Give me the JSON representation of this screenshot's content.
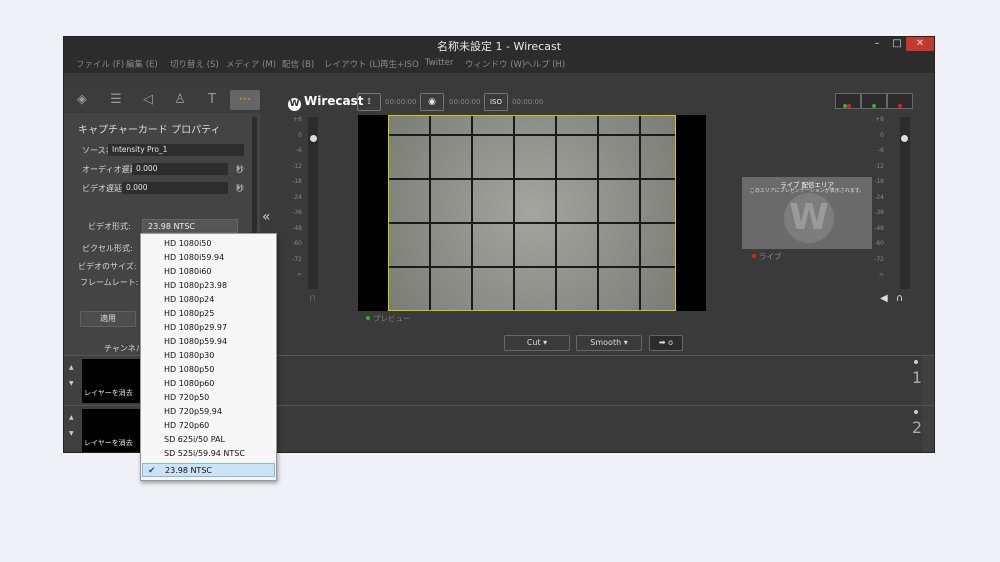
{
  "window": {
    "title": "名称未設定 1 - Wirecast",
    "controls": [
      "–",
      "□",
      "✕"
    ]
  },
  "menu": [
    "ファイル (F)",
    "編集 (E)",
    "切り替え (S)",
    "メディア (M)",
    "配信 (B)",
    "レイアウト (L)",
    "再生+ISO",
    "Twitter",
    "ウィンドウ (W)",
    "ヘルプ (H)"
  ],
  "properties": {
    "title": "キャプチャーカード プロパティ",
    "source_name_label": "ソース名",
    "source_name_value": "Intensity Pro_1",
    "audio_delay_label": "オーディオ遅延:",
    "audio_delay_value": "0.000",
    "video_delay_label": "ビデオ遅延:",
    "video_delay_value": "0.000",
    "sec_unit": "秒",
    "video_format_label": "ビデオ形式:",
    "video_format_value": "23.98 NTSC",
    "pixel_format_label": "ピクセル形式:",
    "video_size_label": "ビデオのサイズ:",
    "frame_rate_label": "フレームレート:",
    "apply_label": "適用",
    "channel_label": "チャンネル:",
    "collapse_icon": "«"
  },
  "toolbar": {
    "brand": "Wirecast",
    "brand_initial": "W",
    "stream_timer": "00:00:00",
    "record_timer": "00:00:00",
    "iso_timer": "00:00:00",
    "iso_label": "ISO"
  },
  "meters": {
    "scale": [
      "+6",
      "0",
      "-6",
      "-12",
      "-18",
      "-24",
      "-36",
      "-48",
      "-60",
      "-72",
      "∞"
    ]
  },
  "preview": {
    "label": "プレビュー"
  },
  "live": {
    "title": "ライブ 配信エリア",
    "subtitle": "このエリアにプレゼンテーションが表示されます。",
    "label": "ライブ"
  },
  "transitions": {
    "cut": "Cut",
    "smooth": "Smooth",
    "go": "➡ o"
  },
  "layers": [
    {
      "label": "レイヤーを消去",
      "number": "1"
    },
    {
      "label": "レイヤーを消去",
      "number": "2"
    }
  ],
  "dropdown": {
    "items": [
      "HD 1080i50",
      "HD 1080i59.94",
      "HD 1080i60",
      "HD 1080p23.98",
      "HD 1080p24",
      "HD 1080p25",
      "HD 1080p29.97",
      "HD 1080p59.94",
      "HD 1080p30",
      "HD 1080p50",
      "HD 1080p60",
      "HD 720p50",
      "HD 720p59.94",
      "HD 720p60",
      "SD 625i/50 PAL",
      "SD 525i/59.94 NTSC",
      "23.98 NTSC"
    ],
    "selected": "23.98 NTSC"
  },
  "colors": {
    "accent": "#e0b200",
    "live_red": "#e02020",
    "preview_green": "#2db52d"
  }
}
